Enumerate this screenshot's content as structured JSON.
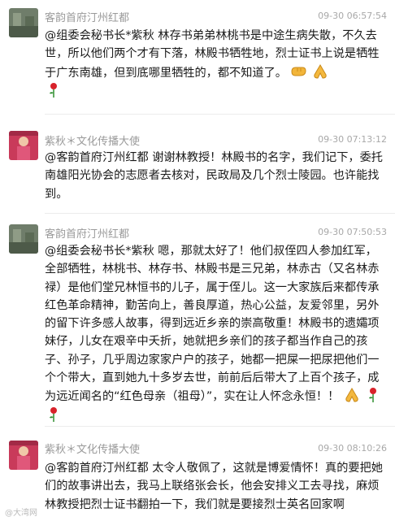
{
  "messages": [
    {
      "sender": "客韵首府汀州红都",
      "time": "09-30 06:57:54",
      "mention": "@组委会秘书长*紫秋",
      "text": " 林存书弟弟林桃书是中途生病失散，不久去世，所以他们两个才有下落，林殿书牺牲地，烈士证书上说是牺牲于广东南雄，但到底哪里牺牲的，都不知道了。",
      "emojis": [
        "fist-icon",
        "pray-icon",
        "rose-icon"
      ]
    },
    {
      "sender": "紫秋＊文化传播大使",
      "time": "09-30 07:13:12",
      "mention": "@客韵首府汀州红都",
      "text": " 谢谢林教授！林殿书的名字，我们记下，委托南雄阳光协会的志愿者去核对，民政局及几个烈士陵园。也许能找到。",
      "emojis": []
    },
    {
      "sender": "客韵首府汀州红都",
      "time": "09-30 07:50:53",
      "mention": "@组委会秘书长*紫秋",
      "text": " 嗯，那就太好了！他们叔侄四人参加红军，全部牺牲，林桃书、林存书、林殿书是三兄弟，林赤古（又名林赤禄）是他们堂兄林恒书的儿子，属于侄儿。这一大家族后来都传承红色革命精神，勤苦向上，善良厚道，热心公益，友爱邻里，另外的留下许多感人故事，得到远近乡亲的崇高敬重！林殿书的遗孀项妹仔，儿女在艰辛中夭折，她就把乡亲们的孩子都当作自己的孩子、孙子，几乎周边家家户户的孩子，她都一把屎一把尿把他们一个个带大，直到她九十多岁去世，前前后后带大了上百个孩子，成为远近闻名的“红色母亲（祖母）”，实在让人怀念永恒！！",
      "emojis": [
        "pray-icon",
        "rose-icon",
        "rose-icon"
      ]
    },
    {
      "sender": "紫秋＊文化传播大使",
      "time": "09-30 08:10:26",
      "mention": "@客韵首府汀州红都",
      "text": " 太令人敬佩了，这就是博爱情怀！真的要把她们的故事讲出去，我马上联络张会长，他会安排义工去寻找，麻烦林教授把烈士证书翻拍一下，我们就是要接烈士英名回家啊",
      "emojis": []
    }
  ],
  "watermark": "@大湾网",
  "colors": {
    "mention": "#1a1a1a",
    "text": "#1a1a1a",
    "name": "#9a9a9a",
    "time": "#a8a8a8",
    "divider": "#ececec"
  }
}
